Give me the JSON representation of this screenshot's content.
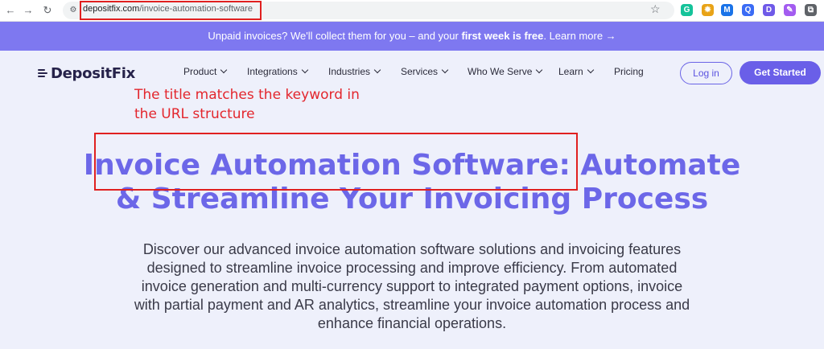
{
  "browser": {
    "back": "←",
    "forward": "→",
    "reload": "↻",
    "site_info": "⚙",
    "url_host": "depositfix.com",
    "url_path": "/invoice-automation-software",
    "star": "☆",
    "extensions": [
      {
        "icon": "grammarly-icon",
        "color": "#15c39a",
        "glyph": "G"
      },
      {
        "icon": "gear-extension-icon",
        "color": "#e8a317",
        "glyph": "✹"
      },
      {
        "icon": "m-extension-icon",
        "color": "#1a73e8",
        "glyph": "M"
      },
      {
        "icon": "search-extension-icon",
        "color": "#3b6cf5",
        "glyph": "Q"
      },
      {
        "icon": "d-extension-icon",
        "color": "#6f5ae8",
        "glyph": "D"
      },
      {
        "icon": "pen-extension-icon",
        "color": "#a35cf0",
        "glyph": "✎"
      },
      {
        "icon": "puzzle-icon",
        "color": "#5f6368",
        "glyph": "⧉"
      }
    ]
  },
  "announcement": {
    "text": "Unpaid invoices? We'll collect them for you – and your ",
    "bold": "first week is free",
    "tail": ". Learn more →"
  },
  "nav": {
    "logo": "DepositFix",
    "items": [
      "Product",
      "Integrations",
      "Industries",
      "Services",
      "Who We Serve",
      "Learn",
      "Pricing"
    ],
    "login": "Log in",
    "get_started": "Get Started"
  },
  "annotation": {
    "line1": "The title matches the keyword in",
    "line2": "the URL structure"
  },
  "hero": {
    "title_line1": "Invoice Automation Software: Automate",
    "title_line2": "& Streamline Your Invoicing Process",
    "description": "Discover our advanced invoice automation software solutions and invoicing features designed to streamline invoice processing and improve efficiency. From automated invoice generation and multi-currency support to integrated payment options, invoice with partial payment and AR analytics, streamline your invoice automation process and enhance financial operations."
  },
  "colors": {
    "accent": "#6c67e8",
    "announce_bg": "#7e78f0",
    "annotation_red": "#e3262d"
  }
}
